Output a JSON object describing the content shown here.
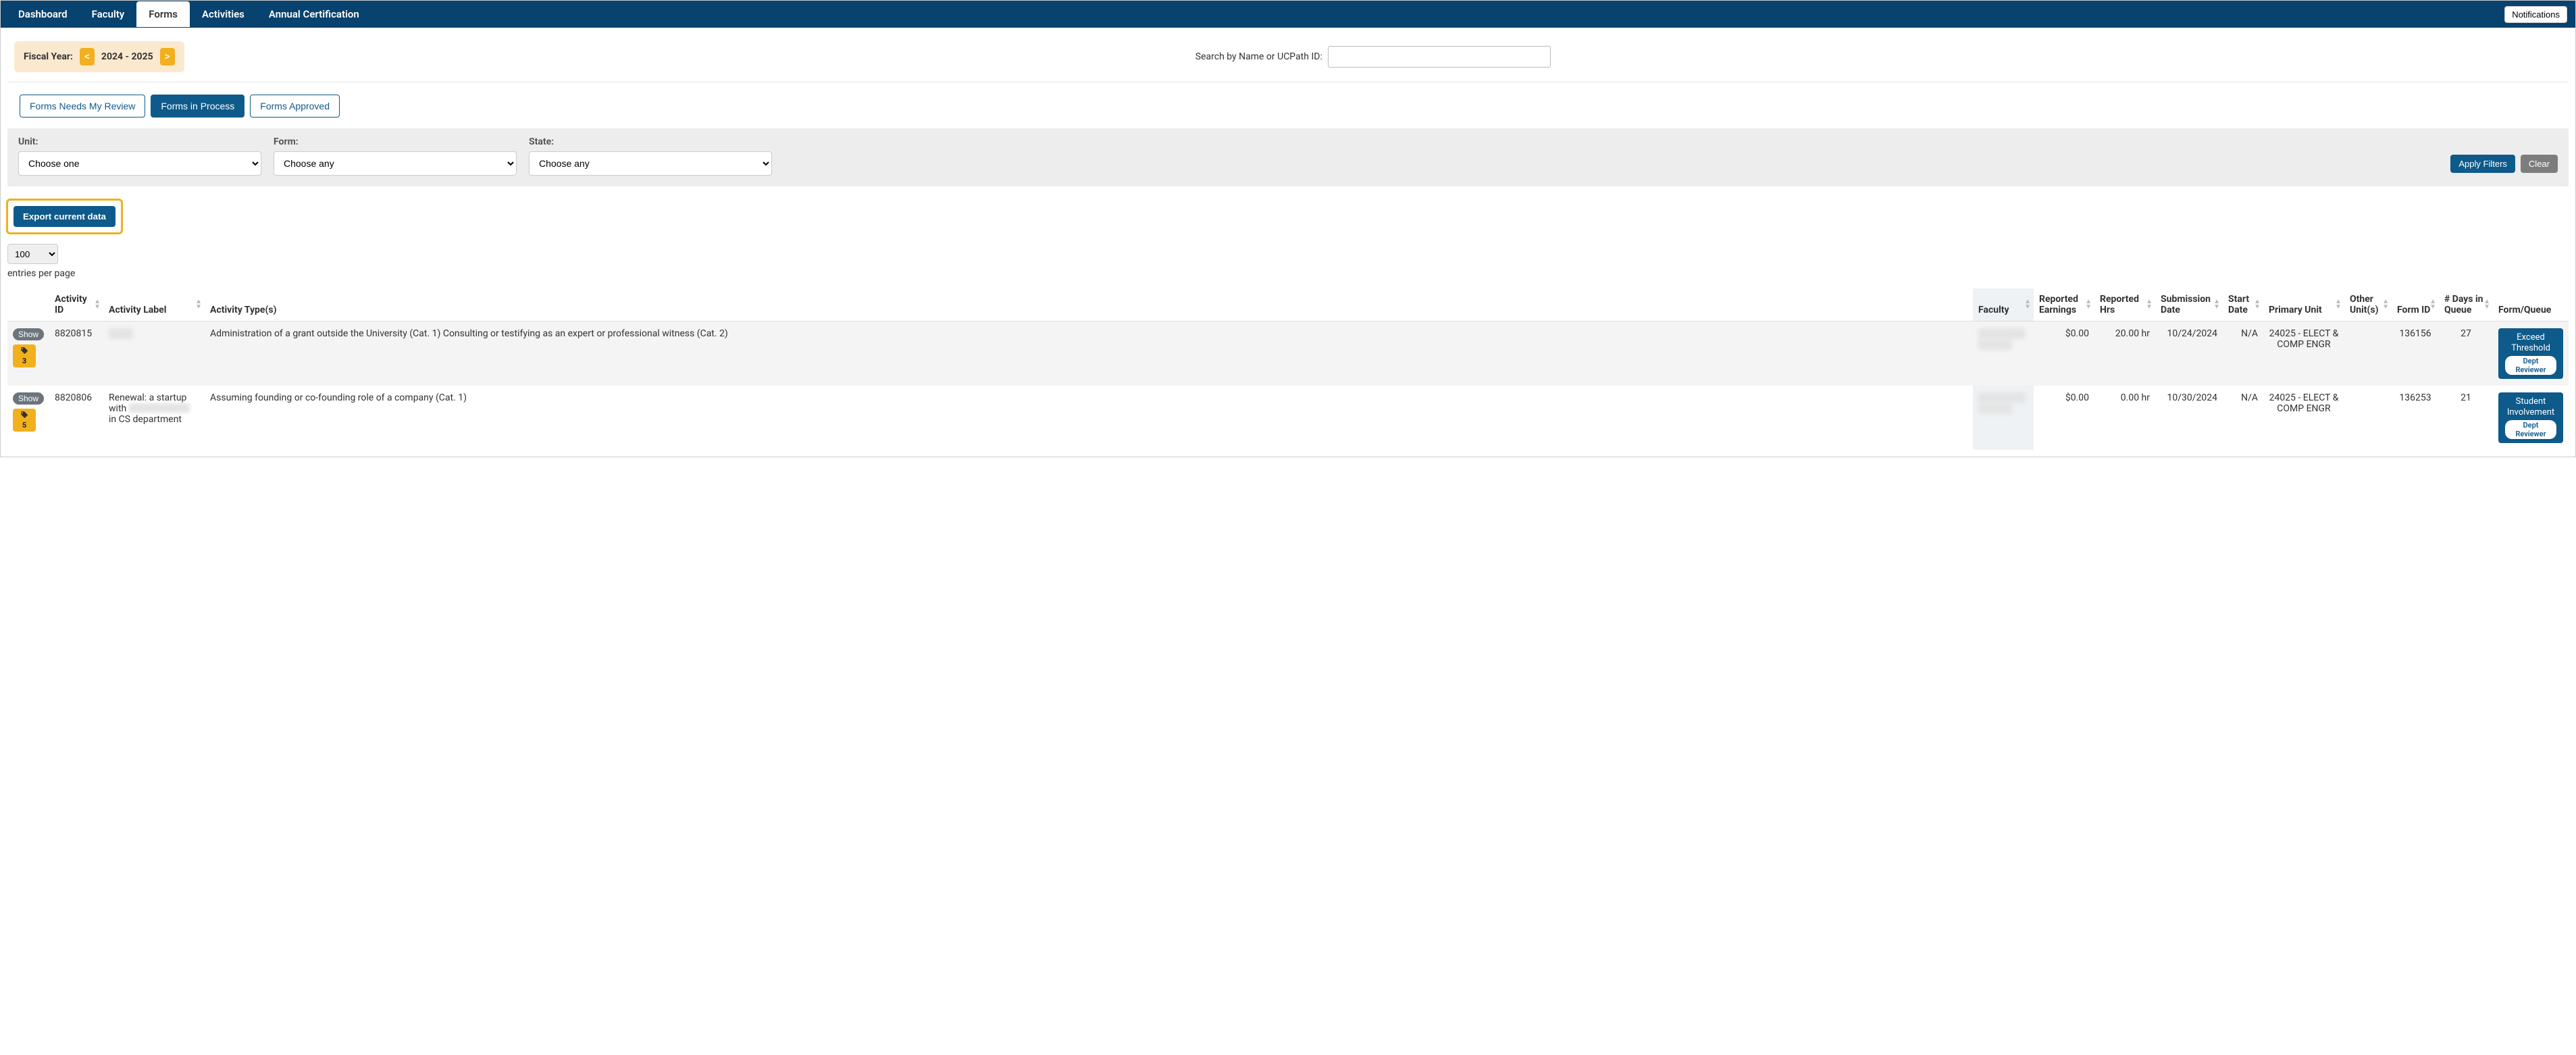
{
  "nav": {
    "tabs": [
      {
        "id": "dashboard",
        "label": "Dashboard",
        "active": false
      },
      {
        "id": "faculty",
        "label": "Faculty",
        "active": false
      },
      {
        "id": "forms",
        "label": "Forms",
        "active": true
      },
      {
        "id": "activities",
        "label": "Activities",
        "active": false
      },
      {
        "id": "annual",
        "label": "Annual Certification",
        "active": false
      }
    ],
    "notifications_label": "Notifications"
  },
  "fiscal_year": {
    "label": "Fiscal Year:",
    "prev_glyph": "<",
    "next_glyph": ">",
    "value": "2024 - 2025"
  },
  "search": {
    "label": "Search by Name or UCPath ID:",
    "value": ""
  },
  "subtabs": [
    {
      "id": "needs-review",
      "label": "Forms Needs My Review",
      "active": false
    },
    {
      "id": "in-process",
      "label": "Forms in Process",
      "active": true
    },
    {
      "id": "approved",
      "label": "Forms Approved",
      "active": false
    }
  ],
  "filters": {
    "unit": {
      "label": "Unit:",
      "placeholder": "Choose one"
    },
    "form": {
      "label": "Form:",
      "placeholder": "Choose any"
    },
    "state": {
      "label": "State:",
      "placeholder": "Choose any"
    },
    "apply_label": "Apply Filters",
    "clear_label": "Clear"
  },
  "export_label": "Export current data",
  "entries": {
    "selected": "100",
    "suffix": "entries per page"
  },
  "columns": [
    "",
    "Activity ID",
    "Activity Label",
    "Activity Type(s)",
    "Faculty",
    "Reported Earnings",
    "Reported Hrs",
    "Submission Date",
    "Start Date",
    "Primary Unit",
    "Other Unit(s)",
    "Form ID",
    "# Days in Queue",
    "Form/Queue"
  ],
  "show_label": "Show",
  "rows": [
    {
      "attachments": "3",
      "activity_id": "8820815",
      "activity_label": "",
      "activity_types": "Administration of a grant outside the University (Cat. 1) Consulting or testifying as an expert or professional witness (Cat. 2)",
      "faculty": "",
      "reported_earnings": "$0.00",
      "reported_hrs": "20.00 hr",
      "submission_date": "10/24/2024",
      "start_date": "N/A",
      "primary_unit": "24025 - ELECT & COMP ENGR",
      "other_units": "",
      "form_id": "136156",
      "days_in_queue": "27",
      "queue_main": "Exceed Threshold",
      "queue_sub": "Dept Reviewer"
    },
    {
      "attachments": "5",
      "activity_id": "8820806",
      "activity_label": "Renewal: a startup with [redacted] in CS department",
      "activity_types": "Assuming founding or co-founding role of a company (Cat. 1)",
      "faculty": "",
      "reported_earnings": "$0.00",
      "reported_hrs": "0.00 hr",
      "submission_date": "10/30/2024",
      "start_date": "N/A",
      "primary_unit": "24025 - ELECT & COMP ENGR",
      "other_units": "",
      "form_id": "136253",
      "days_in_queue": "21",
      "queue_main": "Student Involvement",
      "queue_sub": "Dept Reviewer"
    }
  ]
}
